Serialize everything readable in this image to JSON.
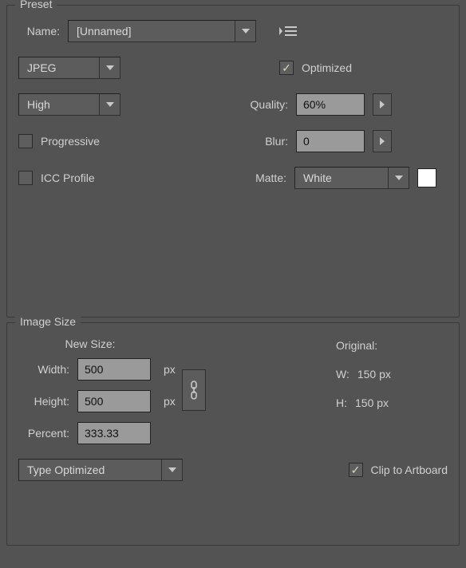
{
  "preset": {
    "legend": "Preset",
    "name_label": "Name:",
    "name_value": "[Unnamed]",
    "format_value": "JPEG",
    "quality_preset_value": "High",
    "optimized_label": "Optimized",
    "optimized_checked": true,
    "quality_label": "Quality:",
    "quality_value": "60%",
    "progressive_label": "Progressive",
    "progressive_checked": false,
    "blur_label": "Blur:",
    "blur_value": "0",
    "icc_label": "ICC Profile",
    "icc_checked": false,
    "matte_label": "Matte:",
    "matte_value": "White",
    "matte_color": "#ffffff"
  },
  "image_size": {
    "legend": "Image Size",
    "new_size_label": "New Size:",
    "original_label": "Original:",
    "width_label": "Width:",
    "width_value": "500",
    "width_unit": "px",
    "height_label": "Height:",
    "height_value": "500",
    "height_unit": "px",
    "orig_w_label": "W:",
    "orig_w_value": "150 px",
    "orig_h_label": "H:",
    "orig_h_value": "150 px",
    "percent_label": "Percent:",
    "percent_value": "333.33",
    "clip_label": "Clip to Artboard",
    "clip_checked": true,
    "antialias_value": "Type Optimized"
  }
}
